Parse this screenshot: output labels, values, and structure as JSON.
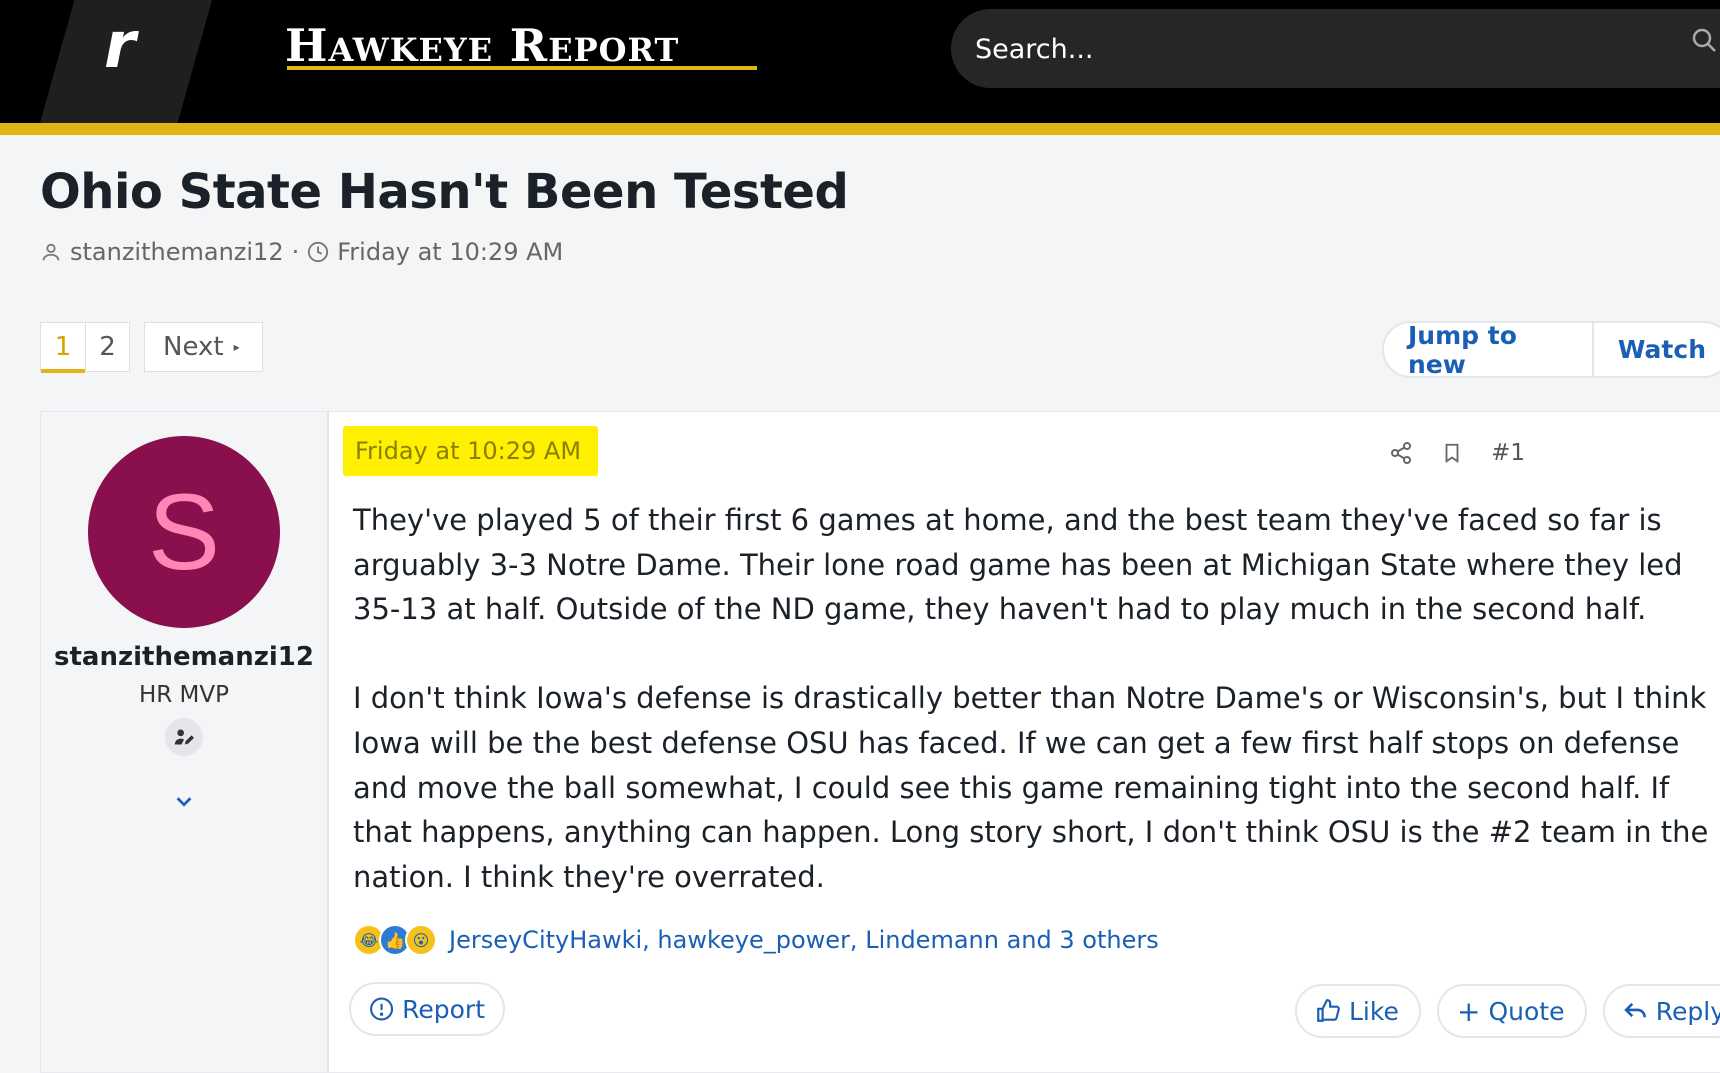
{
  "header": {
    "logo_letter": "r",
    "brand": "Hawkeye Report",
    "search_placeholder": "Search..."
  },
  "thread": {
    "title": "Ohio State Hasn't Been Tested",
    "author": "stanzithemanzi12",
    "separator": "·",
    "date": "Friday at 10:29 AM"
  },
  "pagination": {
    "pages": [
      "1",
      "2"
    ],
    "current": "1",
    "next_label": "Next"
  },
  "actions": {
    "jump_label": "Jump to new",
    "watch_label": "Watch"
  },
  "post": {
    "user": {
      "avatar_letter": "S",
      "name": "stanzithemanzi12",
      "title": "HR MVP"
    },
    "date": "Friday at 10:29 AM",
    "number": "#1",
    "paragraphs": [
      "They've played 5 of their first 6 games at home, and the best team they've faced so far is arguably 3-3 Notre Dame. Their lone road game has been at Michigan State where they led 35-13 at half. Outside of the ND game, they haven't had to play much in the second half.",
      "I don't think Iowa's defense is drastically better than Notre Dame's or Wisconsin's, but I think Iowa will be the best defense OSU has faced. If we can get a few first half stops on defense and move the ball somewhat, I could see this game remaining tight into the second half. If that happens, anything can happen. Long story short, I don't think OSU is the #2 team in the nation. I think they're overrated."
    ],
    "reactions": {
      "icons": [
        "laugh-emoji-icon",
        "like-reaction-icon",
        "wow-emoji-icon"
      ],
      "text": "JerseyCityHawki, hawkeye_power, Lindemann and 3 others"
    },
    "buttons": {
      "report": "Report",
      "like": "Like",
      "quote": "Quote",
      "reply": "Reply"
    }
  },
  "colors": {
    "accent_gold": "#e2b514",
    "link_blue": "#1a5fb4",
    "avatar_bg": "#8a0f4d",
    "highlight": "#ffef00"
  }
}
